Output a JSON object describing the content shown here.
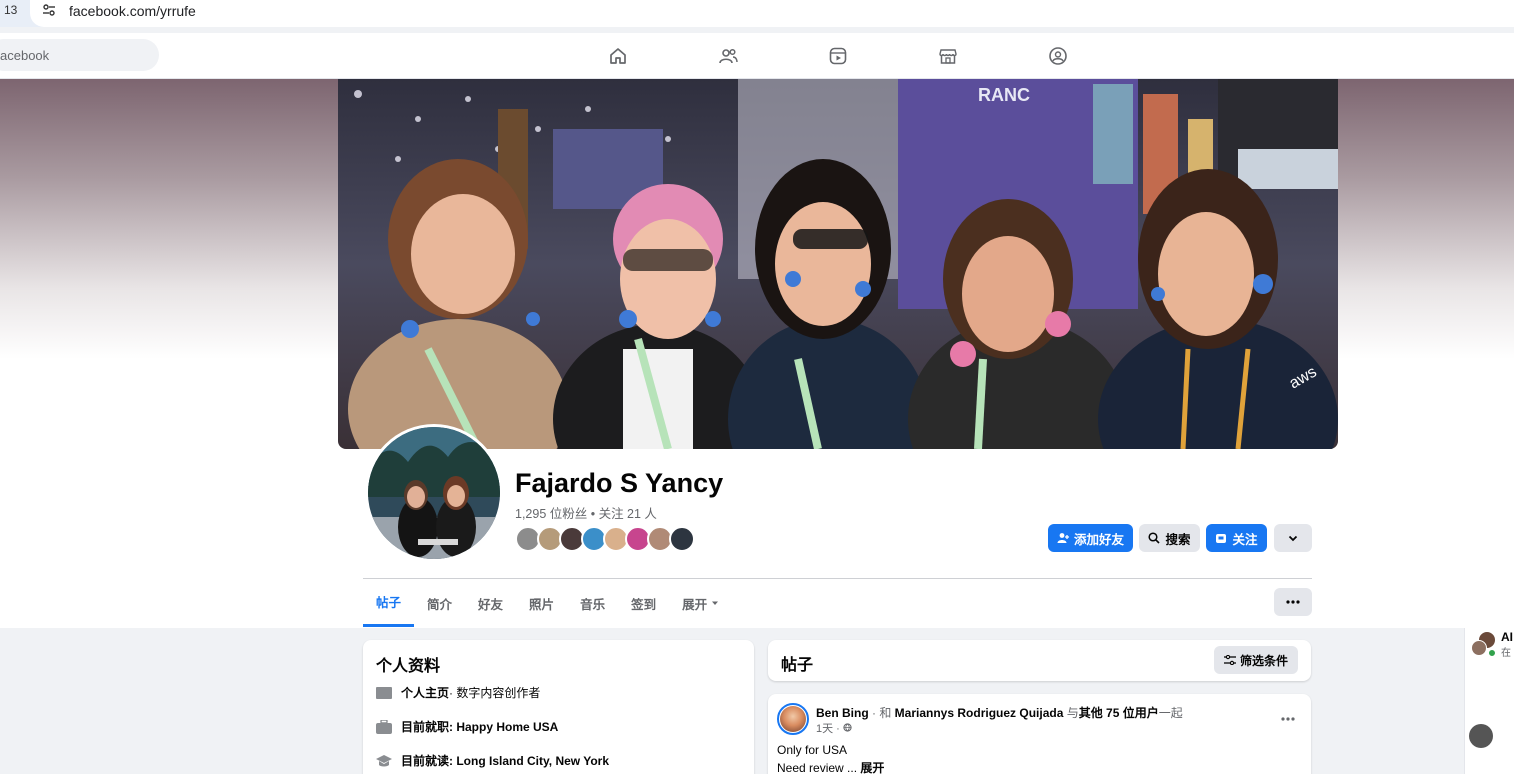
{
  "browser": {
    "tab_number": "13",
    "url": "facebook.com/yrrufe"
  },
  "topnav": {
    "search_placeholder": "acebook",
    "icons": [
      "home-icon",
      "friends-icon",
      "video-icon",
      "marketplace-icon",
      "groups-icon"
    ]
  },
  "profile": {
    "name": "Fajardo S Yancy",
    "stats": "1,295 位粉丝 • 关注 21 人",
    "friend_avatar_count": 8
  },
  "actions": {
    "add_friend": "添加好友",
    "search": "搜索",
    "follow": "关注"
  },
  "tabs": [
    {
      "label": "帖子",
      "active": true
    },
    {
      "label": "简介"
    },
    {
      "label": "好友"
    },
    {
      "label": "照片"
    },
    {
      "label": "音乐"
    },
    {
      "label": "签到"
    },
    {
      "label": "展开"
    }
  ],
  "intro": {
    "title": "个人资料",
    "rows": [
      {
        "icon": "flag-icon",
        "bold": "个人主页",
        "rest": " · 数字内容创作者"
      },
      {
        "icon": "briefcase-icon",
        "bold": "目前就职: Happy Home USA",
        "rest": ""
      },
      {
        "icon": "graduation-cap-icon",
        "bold": "目前就读: Long Island City, New York",
        "rest": ""
      }
    ]
  },
  "posts": {
    "title": "帖子",
    "filter_label": "筛选条件",
    "items": [
      {
        "author": "Ben Bing",
        "with_prefix": " · 和 ",
        "with_name": "Mariannys Rodriguez Quijada",
        "others_prefix": " 与",
        "others": "其他 75 位用户",
        "others_suffix": "一起",
        "time": "1天 · ",
        "line1": "Only for USA",
        "line2": "Need review ... ",
        "expand": "展开"
      }
    ]
  },
  "chat": {
    "partial_name": "AI",
    "partial_status": "在"
  },
  "colors": {
    "accent": "#1877f2",
    "background": "#f0f2f5",
    "secondary_button": "#e4e6eb"
  }
}
